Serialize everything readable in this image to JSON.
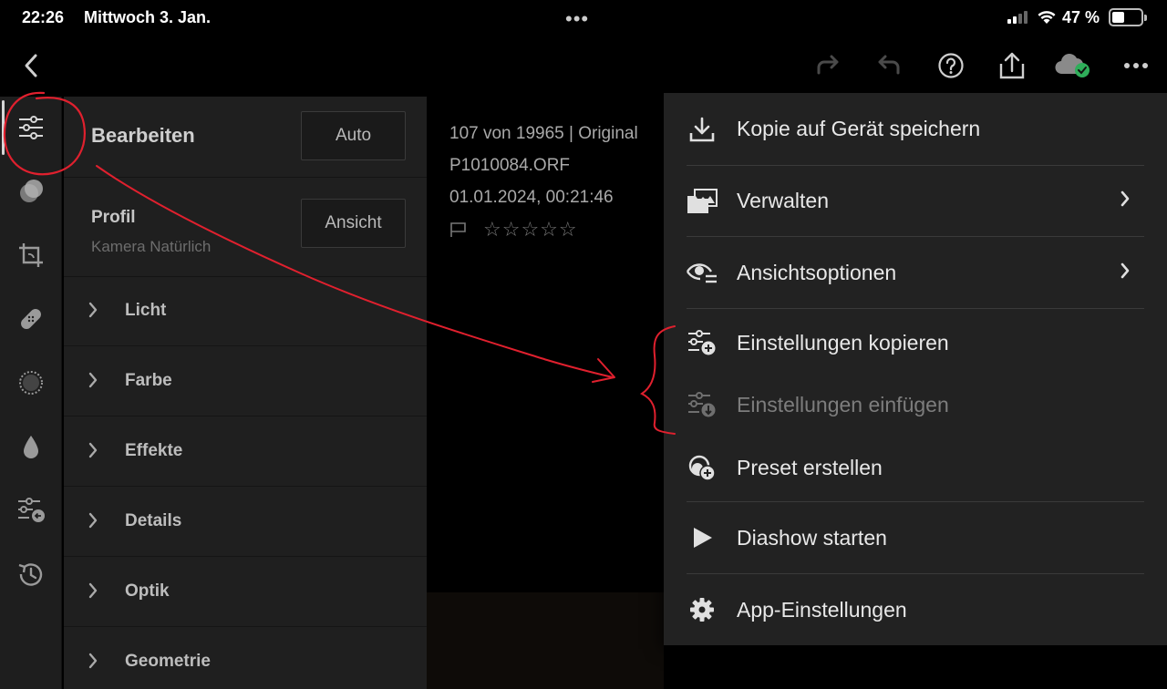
{
  "status_bar": {
    "time": "22:26",
    "date": "Mittwoch 3. Jan.",
    "multitask_dots": "•••",
    "battery_percent": "47 %"
  },
  "toolbar": {
    "back_icon": "chevron-left-icon",
    "redo_icon": "redo-icon",
    "undo_icon": "undo-icon",
    "help_icon": "help-icon",
    "share_icon": "share-icon",
    "cloud_icon": "cloud-synced-icon",
    "more_icon": "more-icon"
  },
  "rail": {
    "items": [
      "sliders-icon",
      "presets-icon",
      "crop-icon",
      "healing-icon",
      "masking-icon",
      "blur-icon",
      "versions-icon",
      "history-icon"
    ],
    "active": "sliders-icon"
  },
  "panel": {
    "title": "Bearbeiten",
    "auto_label": "Auto",
    "profile_label": "Profil",
    "profile_value": "Kamera Natürlich",
    "view_label": "Ansicht",
    "sections": [
      {
        "label": "Licht"
      },
      {
        "label": "Farbe"
      },
      {
        "label": "Effekte"
      },
      {
        "label": "Details"
      },
      {
        "label": "Optik"
      },
      {
        "label": "Geometrie"
      }
    ]
  },
  "photo_info": {
    "position_line": "107 von 19965 | Original",
    "filename": "P1010084.ORF",
    "datetime": "01.01.2024, 00:21:46",
    "stars": "☆☆☆☆☆"
  },
  "menu": {
    "items": [
      {
        "label": "Kopie auf Gerät speichern",
        "icon": "download-icon",
        "submenu": false,
        "disabled": false
      },
      {
        "label": "Verwalten",
        "icon": "folder-images-icon",
        "submenu": true,
        "disabled": false
      },
      {
        "label": "Ansichtsoptionen",
        "icon": "view-options-icon",
        "submenu": true,
        "disabled": false
      },
      {
        "label": "Einstellungen kopieren",
        "icon": "copy-settings-icon",
        "submenu": false,
        "disabled": false
      },
      {
        "label": "Einstellungen einfügen",
        "icon": "paste-settings-icon",
        "submenu": false,
        "disabled": true
      },
      {
        "label": "Preset erstellen",
        "icon": "create-preset-icon",
        "submenu": false,
        "disabled": false
      },
      {
        "label": "Diashow starten",
        "icon": "play-icon",
        "submenu": false,
        "disabled": false
      },
      {
        "label": "App-Einstellungen",
        "icon": "gear-icon",
        "submenu": false,
        "disabled": false
      }
    ]
  },
  "colors": {
    "annotation_red": "#e0202e",
    "cloud_check_green": "#2fae5a",
    "menu_background": "#222222",
    "panel_background": "#1f1f1f"
  }
}
